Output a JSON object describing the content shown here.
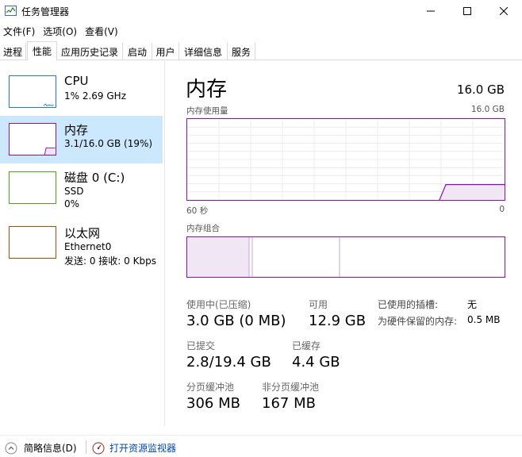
{
  "window": {
    "title": "任务管理器",
    "icons": {
      "app": "task-manager-icon",
      "minimize": "minimize-icon",
      "maximize": "maximize-icon",
      "close": "close-icon"
    }
  },
  "menu": [
    "文件(F)",
    "选项(O)",
    "查看(V)"
  ],
  "tabs": [
    "进程",
    "性能",
    "应用历史记录",
    "启动",
    "用户",
    "详细信息",
    "服务"
  ],
  "active_tab": "性能",
  "resources": [
    {
      "name": "CPU",
      "line1": "1% 2.69 GHz",
      "line2": "",
      "color": "#1a7fc8"
    },
    {
      "name": "内存",
      "line1": "3.1/16.0 GB (19%)",
      "line2": "",
      "color": "#8b12ae"
    },
    {
      "name": "磁盘 0 (C:)",
      "line1": "SSD",
      "line2": "0%",
      "color": "#4da60c"
    },
    {
      "name": "以太网",
      "line1": "Ethernet0",
      "line2": "发送: 0 接收: 0 Kbps",
      "color": "#a74f01"
    }
  ],
  "memory": {
    "title": "内存",
    "total": "16.0 GB",
    "usage_label": "内存使用量",
    "usage_max": "16.0 GB",
    "time_left": "60 秒",
    "time_right": "0",
    "composition_label": "内存组合",
    "usage_fraction": 0.19,
    "composition_segments": {
      "in_use": 0.195,
      "modified": 0.01,
      "standby": 0.275,
      "free": 0.52
    },
    "stats": {
      "in_use_label": "使用中(已压缩)",
      "in_use_value": "3.0 GB (0 MB)",
      "available_label": "可用",
      "available_value": "12.9 GB",
      "committed_label": "已提交",
      "committed_value": "2.8/19.4 GB",
      "cached_label": "已缓存",
      "cached_value": "4.4 GB",
      "paged_label": "分页缓冲池",
      "paged_value": "306 MB",
      "nonpaged_label": "非分页缓冲池",
      "nonpaged_value": "167 MB",
      "slots_label": "已使用的插槽:",
      "slots_value": "无",
      "reserved_label": "为硬件保留的内存:",
      "reserved_value": "0.5 MB"
    },
    "color": "#8b12ae"
  },
  "footer": {
    "summary": "简略信息(D)",
    "resource_monitor": "打开资源监视器",
    "icons": {
      "summary": "chevron-up-icon",
      "monitor": "resource-monitor-icon"
    }
  }
}
